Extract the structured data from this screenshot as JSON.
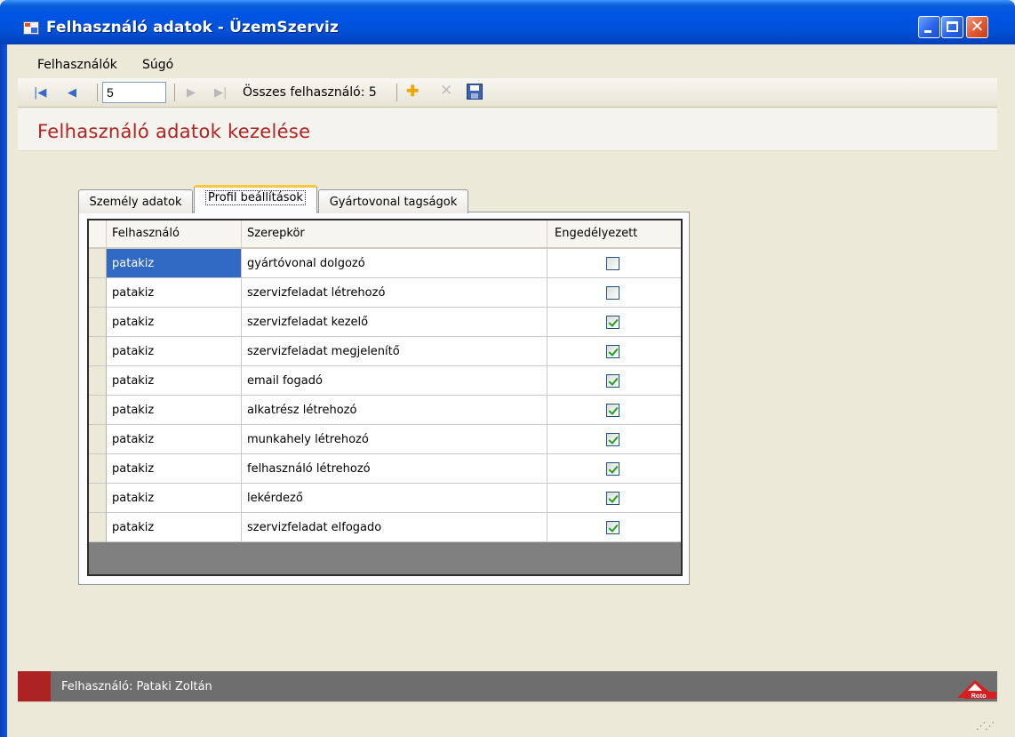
{
  "window": {
    "title": "Felhasználó adatok - ÜzemSzerviz"
  },
  "menu": {
    "users": "Felhasználók",
    "help": "Súgó"
  },
  "toolbar": {
    "position": "5",
    "total_label": "Összes felhasználó: 5",
    "first_icon": "first-record-icon",
    "prev_icon": "previous-record-icon",
    "next_icon": "next-record-icon",
    "last_icon": "last-record-icon",
    "add_icon": "add-icon",
    "delete_icon": "delete-icon",
    "save_icon": "save-icon"
  },
  "page": {
    "title": "Felhasználó adatok kezelése"
  },
  "tabs": [
    {
      "label": "Személy adatok"
    },
    {
      "label": "Profil beállítások"
    },
    {
      "label": "Gyártovonal tagságok"
    }
  ],
  "grid": {
    "columns": [
      "Felhasználó",
      "Szerepkör",
      "Engedélyezett"
    ],
    "rows": [
      {
        "user": "patakiz",
        "role": "gyártóvonal dolgozó",
        "enabled": false
      },
      {
        "user": "patakiz",
        "role": "szervizfeladat létrehozó",
        "enabled": false
      },
      {
        "user": "patakiz",
        "role": "szervizfeladat kezelő",
        "enabled": true
      },
      {
        "user": "patakiz",
        "role": "szervizfeladat megjelenítő",
        "enabled": true
      },
      {
        "user": "patakiz",
        "role": "email fogadó",
        "enabled": true
      },
      {
        "user": "patakiz",
        "role": "alkatrész létrehozó",
        "enabled": true
      },
      {
        "user": "patakiz",
        "role": "munkahely létrehozó",
        "enabled": true
      },
      {
        "user": "patakiz",
        "role": "felhasználó létrehozó",
        "enabled": true
      },
      {
        "user": "patakiz",
        "role": "lekérdező",
        "enabled": true
      },
      {
        "user": "patakiz",
        "role": "szervizfeladat elfogado",
        "enabled": true
      }
    ]
  },
  "status": {
    "user_label": "Felhasználó: Pataki Zoltán",
    "logo_text": "Roto"
  },
  "colors": {
    "title_red": "#b22222",
    "selection_blue": "#316ac5",
    "status_gray": "#6e6e6e"
  }
}
